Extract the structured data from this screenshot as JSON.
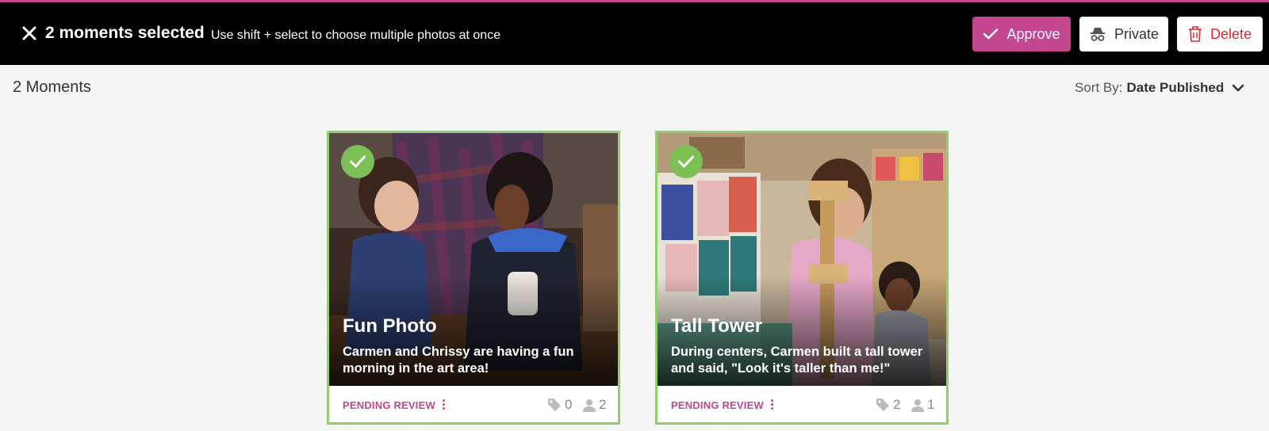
{
  "topbar": {
    "selection_title": "2 moments selected",
    "selection_hint": "Use shift + select to choose multiple photos at once",
    "approve_label": "Approve",
    "private_label": "Private",
    "delete_label": "Delete"
  },
  "list": {
    "count_label": "2 Moments",
    "sort_prefix": "Sort By:",
    "sort_value": "Date Published"
  },
  "moments": [
    {
      "title": "Fun Photo",
      "description": "Carmen and Chrissy are having a fun morning in the art area!",
      "status": "PENDING REVIEW",
      "tags": "0",
      "people": "2"
    },
    {
      "title": "Tall Tower",
      "description": "During centers, Carmen built a tall tower and said, \"Look it's taller than me!\"",
      "status": "PENDING REVIEW",
      "tags": "2",
      "people": "1"
    }
  ],
  "colors": {
    "accent": "#c2478f",
    "selected_border": "#8ed16b",
    "check_green": "#7cbf55",
    "delete_red": "#e0262f"
  }
}
